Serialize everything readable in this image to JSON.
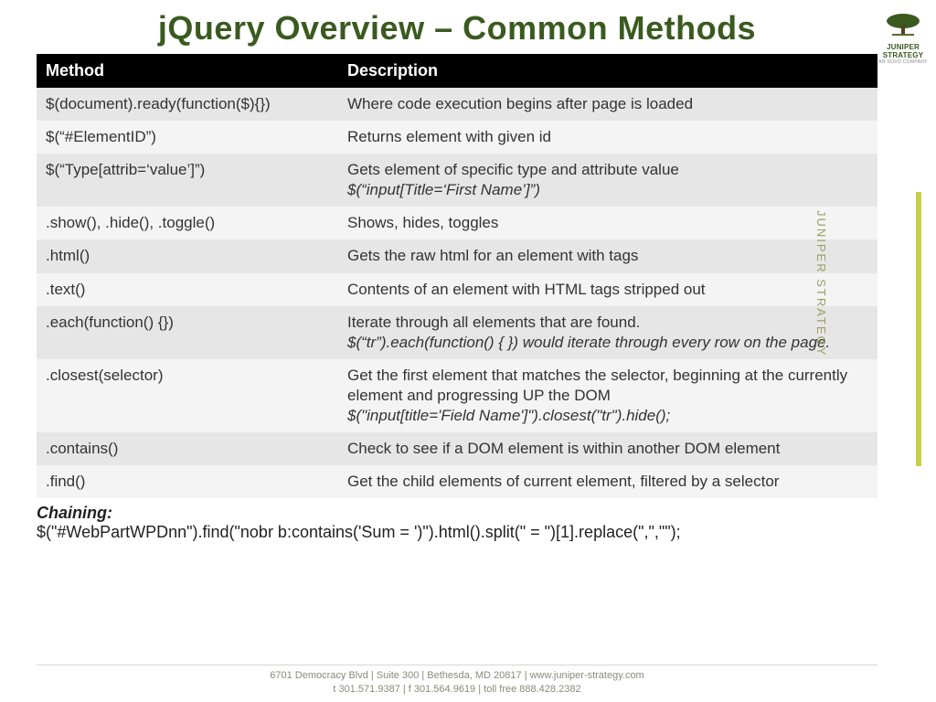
{
  "title": "jQuery Overview – Common Methods",
  "table": {
    "headers": {
      "method": "Method",
      "desc": "Description"
    },
    "rows": [
      {
        "method": "$(document).ready(function($){})",
        "desc": "Where code execution begins after page is loaded"
      },
      {
        "method": "$(“#ElementID”)",
        "desc": "Returns element with given id"
      },
      {
        "method": "$(“Type[attrib=‘value’]”)",
        "desc": "Gets element of specific type and attribute value",
        "desc2": "$(“input[Title=‘First Name’]”)"
      },
      {
        "method": ".show(), .hide(), .toggle()",
        "desc": "Shows, hides, toggles"
      },
      {
        "method": ".html()",
        "desc": "Gets the raw html for an element with tags"
      },
      {
        "method": ".text()",
        "desc": "Contents of an element with HTML tags stripped out"
      },
      {
        "method": ".each(function() {})",
        "desc": "Iterate through all elements that are found.",
        "desc2": "$(“tr”).each(function() { }) would iterate through every row on the page."
      },
      {
        "method": ".closest(selector)",
        "desc": "Get the first element that matches the selector, beginning at the currently element and progressing UP the DOM",
        "desc2": "$(\"input[title='Field Name']\").closest(\"tr\").hide();"
      },
      {
        "method": ".contains()",
        "desc": "Check to see if a DOM element is within another DOM element"
      },
      {
        "method": ".find()",
        "desc": "Get the child elements of current element, filtered by a selector"
      }
    ]
  },
  "chaining": {
    "label": "Chaining:",
    "code": "$(\"#WebPartWPDnn\").find(\"nobr b:contains('Sum = ')\").html().split(\" = \")[1].replace(\",\",\"\");"
  },
  "footer": {
    "line1": "6701 Democracy Blvd | Suite 300 | Bethesda, MD 20817 | www.juniper-strategy.com",
    "line2": "t 301.571.9387 | f 301.564.9619 | toll free 888.428.2382"
  },
  "brand": {
    "name": "JUNIPER",
    "name2": "STRATEGY",
    "sub": "AN SOVO COMPANY",
    "vertical": "JUNIPER STRATEGY"
  }
}
